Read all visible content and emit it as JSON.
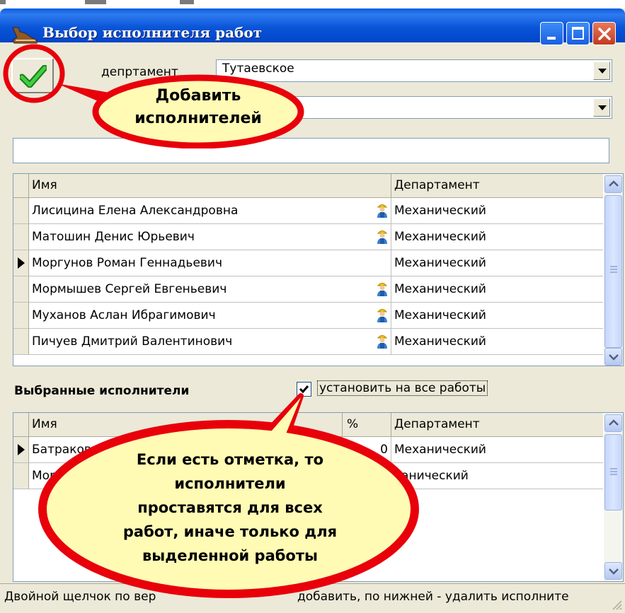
{
  "window": {
    "title": "Выбор исполнителя работ",
    "buttons": [
      "minimize",
      "maximize",
      "close"
    ]
  },
  "toolbar": {
    "department_label": "депртамент",
    "department_value": "Тутаевское",
    "second_combo_value": "",
    "search_value": ""
  },
  "top_grid": {
    "columns": [
      "Имя",
      "Департамент"
    ],
    "rows": [
      {
        "name": "Лисицина Елена Александровна",
        "dept": "Механический",
        "worker_icon": true,
        "current": false
      },
      {
        "name": "Матошин Денис Юрьевич",
        "dept": "Механический",
        "worker_icon": true,
        "current": false
      },
      {
        "name": "Моргунов Роман Геннадьевич",
        "dept": "Механический",
        "worker_icon": false,
        "current": true
      },
      {
        "name": "Мормышев Сергей Евгеньевич",
        "dept": "Механический",
        "worker_icon": true,
        "current": false
      },
      {
        "name": "Муханов Аслан Ибрагимович",
        "dept": "Механический",
        "worker_icon": true,
        "current": false
      },
      {
        "name": "Пичуев Дмитрий Валентинович",
        "dept": "Механический",
        "worker_icon": true,
        "current": false
      }
    ]
  },
  "selected": {
    "label": "Выбранные исполнители",
    "apply_all_label": "установить на все работы",
    "apply_all_checked": true
  },
  "bottom_grid": {
    "columns": [
      "Имя",
      "%",
      "Департамент"
    ],
    "rows": [
      {
        "name": "Батракова Ал",
        "pct": "0",
        "dept": "Механический",
        "current": true
      },
      {
        "name": "Морг",
        "pct": "",
        "dept": "ханический",
        "current": false
      }
    ]
  },
  "callouts": {
    "add": "Добавить исполнителей",
    "add_lines": [
      "Добавить",
      "исполнителей"
    ],
    "note_lines": [
      "Если есть отметка, то",
      "исполнители",
      "проставятся для всех",
      "работ, иначе только для",
      "выделенной работы"
    ]
  },
  "status": {
    "text_left": "Двойной щелчок по вер",
    "text_right": "добавить, по нижней - удалить исполните"
  },
  "colors": {
    "title_bar": "#0a55d8",
    "window_bg": "#ece9d8",
    "callout_fill": "#fffbb5",
    "callout_border": "#e8000b",
    "check_green": "#2db52d"
  }
}
